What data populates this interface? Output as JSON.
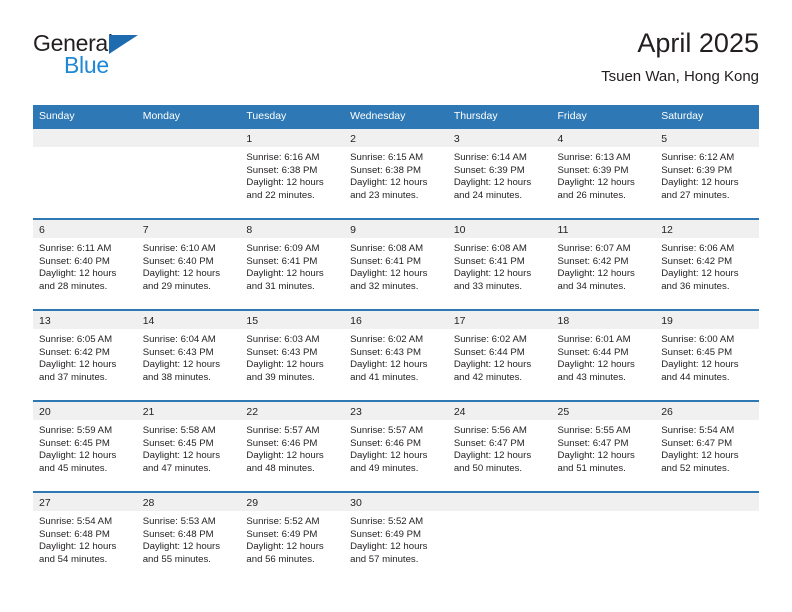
{
  "brand": {
    "line1": "General",
    "line2": "Blue",
    "triangle_color": "#1e6bb0",
    "blue_text_color": "#1e87d6"
  },
  "header": {
    "title": "April 2025",
    "subtitle": "Tsuen Wan, Hong Kong"
  },
  "theme": {
    "header_blue": "#2e79b5",
    "daynum_band": "#f0f0f0",
    "text": "#231f20"
  },
  "calendar": {
    "weekday_headers": [
      "Sunday",
      "Monday",
      "Tuesday",
      "Wednesday",
      "Thursday",
      "Friday",
      "Saturday"
    ],
    "weeks": [
      [
        {
          "day": "",
          "lines": []
        },
        {
          "day": "",
          "lines": []
        },
        {
          "day": "1",
          "lines": [
            "Sunrise: 6:16 AM",
            "Sunset: 6:38 PM",
            "Daylight: 12 hours",
            "and 22 minutes."
          ]
        },
        {
          "day": "2",
          "lines": [
            "Sunrise: 6:15 AM",
            "Sunset: 6:38 PM",
            "Daylight: 12 hours",
            "and 23 minutes."
          ]
        },
        {
          "day": "3",
          "lines": [
            "Sunrise: 6:14 AM",
            "Sunset: 6:39 PM",
            "Daylight: 12 hours",
            "and 24 minutes."
          ]
        },
        {
          "day": "4",
          "lines": [
            "Sunrise: 6:13 AM",
            "Sunset: 6:39 PM",
            "Daylight: 12 hours",
            "and 26 minutes."
          ]
        },
        {
          "day": "5",
          "lines": [
            "Sunrise: 6:12 AM",
            "Sunset: 6:39 PM",
            "Daylight: 12 hours",
            "and 27 minutes."
          ]
        }
      ],
      [
        {
          "day": "6",
          "lines": [
            "Sunrise: 6:11 AM",
            "Sunset: 6:40 PM",
            "Daylight: 12 hours",
            "and 28 minutes."
          ]
        },
        {
          "day": "7",
          "lines": [
            "Sunrise: 6:10 AM",
            "Sunset: 6:40 PM",
            "Daylight: 12 hours",
            "and 29 minutes."
          ]
        },
        {
          "day": "8",
          "lines": [
            "Sunrise: 6:09 AM",
            "Sunset: 6:41 PM",
            "Daylight: 12 hours",
            "and 31 minutes."
          ]
        },
        {
          "day": "9",
          "lines": [
            "Sunrise: 6:08 AM",
            "Sunset: 6:41 PM",
            "Daylight: 12 hours",
            "and 32 minutes."
          ]
        },
        {
          "day": "10",
          "lines": [
            "Sunrise: 6:08 AM",
            "Sunset: 6:41 PM",
            "Daylight: 12 hours",
            "and 33 minutes."
          ]
        },
        {
          "day": "11",
          "lines": [
            "Sunrise: 6:07 AM",
            "Sunset: 6:42 PM",
            "Daylight: 12 hours",
            "and 34 minutes."
          ]
        },
        {
          "day": "12",
          "lines": [
            "Sunrise: 6:06 AM",
            "Sunset: 6:42 PM",
            "Daylight: 12 hours",
            "and 36 minutes."
          ]
        }
      ],
      [
        {
          "day": "13",
          "lines": [
            "Sunrise: 6:05 AM",
            "Sunset: 6:42 PM",
            "Daylight: 12 hours",
            "and 37 minutes."
          ]
        },
        {
          "day": "14",
          "lines": [
            "Sunrise: 6:04 AM",
            "Sunset: 6:43 PM",
            "Daylight: 12 hours",
            "and 38 minutes."
          ]
        },
        {
          "day": "15",
          "lines": [
            "Sunrise: 6:03 AM",
            "Sunset: 6:43 PM",
            "Daylight: 12 hours",
            "and 39 minutes."
          ]
        },
        {
          "day": "16",
          "lines": [
            "Sunrise: 6:02 AM",
            "Sunset: 6:43 PM",
            "Daylight: 12 hours",
            "and 41 minutes."
          ]
        },
        {
          "day": "17",
          "lines": [
            "Sunrise: 6:02 AM",
            "Sunset: 6:44 PM",
            "Daylight: 12 hours",
            "and 42 minutes."
          ]
        },
        {
          "day": "18",
          "lines": [
            "Sunrise: 6:01 AM",
            "Sunset: 6:44 PM",
            "Daylight: 12 hours",
            "and 43 minutes."
          ]
        },
        {
          "day": "19",
          "lines": [
            "Sunrise: 6:00 AM",
            "Sunset: 6:45 PM",
            "Daylight: 12 hours",
            "and 44 minutes."
          ]
        }
      ],
      [
        {
          "day": "20",
          "lines": [
            "Sunrise: 5:59 AM",
            "Sunset: 6:45 PM",
            "Daylight: 12 hours",
            "and 45 minutes."
          ]
        },
        {
          "day": "21",
          "lines": [
            "Sunrise: 5:58 AM",
            "Sunset: 6:45 PM",
            "Daylight: 12 hours",
            "and 47 minutes."
          ]
        },
        {
          "day": "22",
          "lines": [
            "Sunrise: 5:57 AM",
            "Sunset: 6:46 PM",
            "Daylight: 12 hours",
            "and 48 minutes."
          ]
        },
        {
          "day": "23",
          "lines": [
            "Sunrise: 5:57 AM",
            "Sunset: 6:46 PM",
            "Daylight: 12 hours",
            "and 49 minutes."
          ]
        },
        {
          "day": "24",
          "lines": [
            "Sunrise: 5:56 AM",
            "Sunset: 6:47 PM",
            "Daylight: 12 hours",
            "and 50 minutes."
          ]
        },
        {
          "day": "25",
          "lines": [
            "Sunrise: 5:55 AM",
            "Sunset: 6:47 PM",
            "Daylight: 12 hours",
            "and 51 minutes."
          ]
        },
        {
          "day": "26",
          "lines": [
            "Sunrise: 5:54 AM",
            "Sunset: 6:47 PM",
            "Daylight: 12 hours",
            "and 52 minutes."
          ]
        }
      ],
      [
        {
          "day": "27",
          "lines": [
            "Sunrise: 5:54 AM",
            "Sunset: 6:48 PM",
            "Daylight: 12 hours",
            "and 54 minutes."
          ]
        },
        {
          "day": "28",
          "lines": [
            "Sunrise: 5:53 AM",
            "Sunset: 6:48 PM",
            "Daylight: 12 hours",
            "and 55 minutes."
          ]
        },
        {
          "day": "29",
          "lines": [
            "Sunrise: 5:52 AM",
            "Sunset: 6:49 PM",
            "Daylight: 12 hours",
            "and 56 minutes."
          ]
        },
        {
          "day": "30",
          "lines": [
            "Sunrise: 5:52 AM",
            "Sunset: 6:49 PM",
            "Daylight: 12 hours",
            "and 57 minutes."
          ]
        },
        {
          "day": "",
          "lines": []
        },
        {
          "day": "",
          "lines": []
        },
        {
          "day": "",
          "lines": []
        }
      ]
    ]
  }
}
